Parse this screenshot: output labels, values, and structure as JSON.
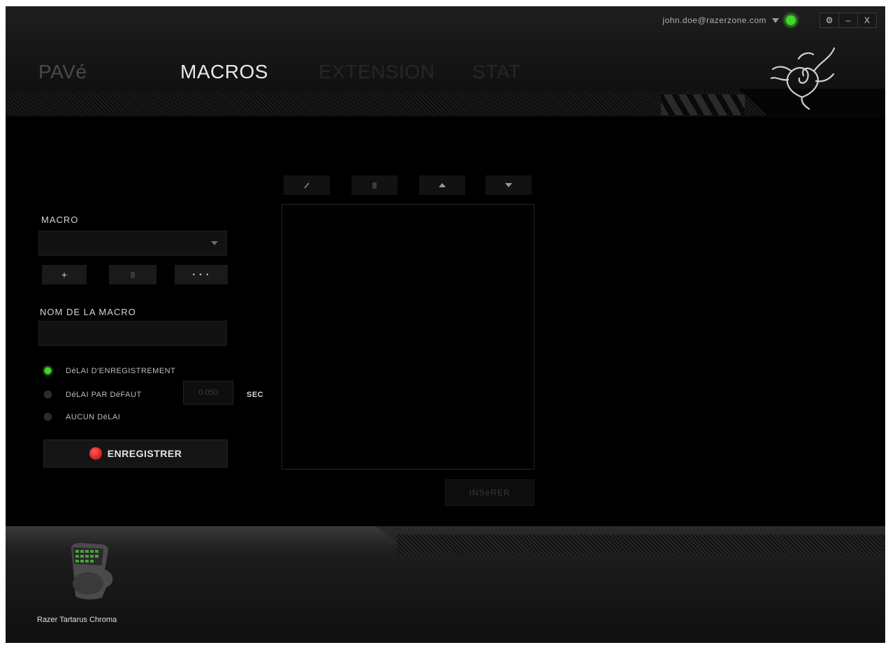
{
  "header": {
    "tabs": [
      {
        "label": "PAVé",
        "state": "inactive"
      },
      {
        "label": "MACROS",
        "state": "active"
      },
      {
        "label": "EXTENSION",
        "state": "disabled"
      },
      {
        "label": "STAT",
        "state": "disabled"
      }
    ],
    "account_email": "john.doe@razerzone.com",
    "window_controls": {
      "settings": "⚙",
      "minimize": "–",
      "close": "X"
    }
  },
  "macro_panel": {
    "macro_label": "MACRO",
    "macro_select_value": "",
    "buttons": {
      "add": "+",
      "delete_icon": "trash-icon",
      "more": "• • •"
    },
    "macro_name_label": "NOM DE LA MACRO",
    "macro_name_value": "",
    "delay_options": [
      {
        "label": "DéLAI D'ENREGISTREMENT",
        "selected": true
      },
      {
        "label": "DéLAI PAR DéFAUT",
        "selected": false
      },
      {
        "label": "AUCUN DéLAI",
        "selected": false
      }
    ],
    "default_delay_value": "0.050",
    "delay_unit": "SEC",
    "record_label": "ENREGISTRER"
  },
  "editor": {
    "toolbar": [
      "edit-icon",
      "delete-icon",
      "move-up-icon",
      "move-down-icon"
    ],
    "insert_label": "INSéRER"
  },
  "footer": {
    "device_name": "Razer Tartarus Chroma"
  },
  "colors": {
    "accent_green": "#44d62c",
    "record_red": "#e00000",
    "background": "#000000"
  }
}
